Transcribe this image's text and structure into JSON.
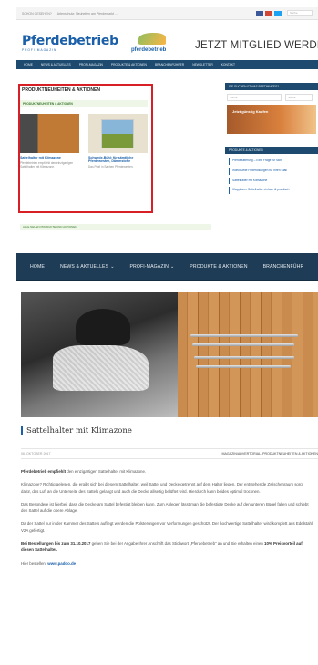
{
  "shot1": {
    "topbar": {
      "left_text": "SCHON GESEHEN?",
      "ticker": "Artenschutz: Neuheiten am Pferdemarkt …",
      "social_colors": [
        "#3b5998",
        "#d14836",
        "#1da1f2"
      ],
      "search_placeholder": "Suche"
    },
    "logo": {
      "title": "Pferdebetrieb",
      "subtitle": "PROFI-MAGAZIN"
    },
    "logo2": {
      "text": "pferdebetrieb"
    },
    "cta": {
      "text": "JETZT MITGLIED WERDEN!",
      "tagline": ""
    },
    "nav": [
      "HOME",
      "NEWS & AKTUELLES",
      "PROFI-MAGAZIN",
      "PRODUKTE & AKTIONEN",
      "BRANCHENFÜHRER",
      "NEWSLETTER",
      "KONTAKT"
    ],
    "section_title": "PRODUKTNEUHEITEN & AKTIONEN",
    "section_bar": "PRODUKTNEUHEITEN & AKTIONEN",
    "cards": [
      {
        "title": "Sattelhalter mit Klimazone",
        "excerpt": "Pferdebetrieb empfiehlt den einzigartigen Sattelhalter mit Klimazone."
      },
      {
        "title": "Schwede-Bühl: für sämtliche Pferdewesten, Dämmstoffe",
        "excerpt": "Das Profi in Sachen Pferdewesten."
      }
    ],
    "bottom_bar": "ALLE NEUEN PRODUKTE UND AKTIONEN",
    "sidebar": {
      "search_head": "SIE SUCHEN ETWAS BESTIMMTES?",
      "search_label": "Suche",
      "search_button": "Suche",
      "ad_text": "Jetzt günstig Kaufen",
      "list_head": "PRODUKTE & AKTIONEN",
      "links": [
        "Pferdefütterung – Eine Frage für sich",
        "Individuelle Futterlösungen für Ihren Stall",
        "Sattelhalter mit Klimazone",
        "Klappbarer Sattelhalter einfach & praktisch"
      ]
    }
  },
  "shot2": {
    "nav": [
      {
        "label": "HOME",
        "chevron": ""
      },
      {
        "label": "NEWS & AKTUELLES",
        "chevron": "⌄"
      },
      {
        "label": "PROFI-MAGAZIN",
        "chevron": "⌄"
      },
      {
        "label": "PRODUKTE & AKTIONEN",
        "chevron": ""
      },
      {
        "label": "BRANCHENFÜHR",
        "chevron": ""
      }
    ],
    "article": {
      "title": "Sattelhalter mit Klimazone",
      "date": "06. OKTOBER 2017",
      "categories": "MAGAZIN/ADVERTORIAL, PRODUKTNEUHEITEN & AKTIONEN",
      "p1_bold": "Pferdebetrieb empfiehlt",
      "p1_rest": " den einzigartigen Sattelhalter mit Klimazone.",
      "p2": "Klimazone? Richtig gelesen, die ergibt sich bei diesem Sattelhalter, weil Sattel und Decke getrennt auf dem Halter liegen. Der entstehende Zwischenraum sorgt dafür, das Luft an die Unterseite des Sattels gelangt und auch die Decke allseitig belüftet wird. Hierdurch kann beides optimal trocknen.",
      "p3": "Das Besondere ist hierbei: dass die Decke am Sattel befestigt bleiben kann. Zum Ablegen lässt man die befestigte Decke auf den unteren Bügel fallen und schiebt den Sattel auf die obere Ablage.",
      "p4": "Da der Sattel nur in der Kammer des Sattels aufliegt werden die Polsterungen vor Verformungen geschützt. Der hochwertige Sattelhalter wird komplett aus Edelstahl V2A gefertigt.",
      "p5_bold": "Bei Bestellungen bis zum 31.10.2017",
      "p5_mid": " geben Sie bei der Angabe Ihrer Anschrift das Stichwort „Pferdebetrieb“ an und Sie erhalten einen ",
      "p5_bold2": "10% Preisvorteil auf diesen Sattelhalter.",
      "p6_prefix": "Hier bestellen: ",
      "p6_link": "www.paddo.de"
    }
  }
}
